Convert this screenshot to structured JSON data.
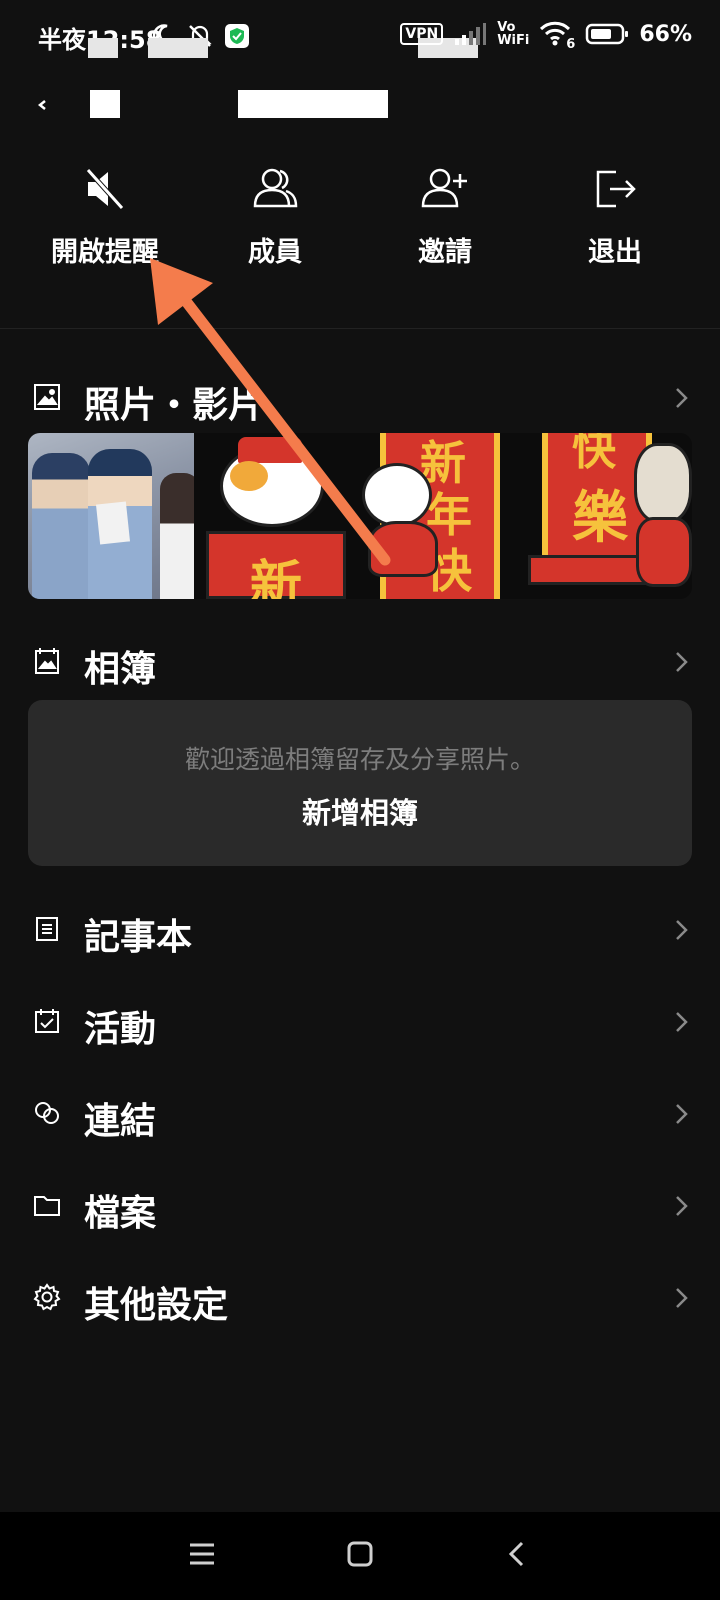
{
  "status_bar": {
    "time": "半夜12:58",
    "battery": "66%",
    "vpn": "VPN",
    "vowifi_top": "Vo",
    "vowifi_bottom": "WiFi",
    "wifi_badge": "6"
  },
  "actions": [
    {
      "label": "開啟提醒",
      "icon": "bell-muted-icon"
    },
    {
      "label": "成員",
      "icon": "members-icon"
    },
    {
      "label": "邀請",
      "icon": "invite-icon"
    },
    {
      "label": "退出",
      "icon": "exit-icon"
    }
  ],
  "sections": {
    "photos": {
      "title": "照片・影片"
    },
    "albums": {
      "title": "相簿",
      "hint": "歡迎透過相簿留存及分享照片。",
      "add_label": "新增相簿"
    },
    "notes": {
      "title": "記事本"
    },
    "events": {
      "title": "活動"
    },
    "links": {
      "title": "連結"
    },
    "files": {
      "title": "檔案"
    },
    "settings": {
      "title": "其他設定"
    }
  },
  "thumbnails": {
    "t2_text": "新",
    "t3_text_1": "新",
    "t3_text_2": "年",
    "t3_text_3": "快",
    "t4_text_1": "快",
    "t4_text_2": "樂"
  },
  "colors": {
    "background": "#111111",
    "card": "#2a2a2a",
    "arrow": "#f47c4c",
    "hint_text": "#7d7d7d"
  }
}
